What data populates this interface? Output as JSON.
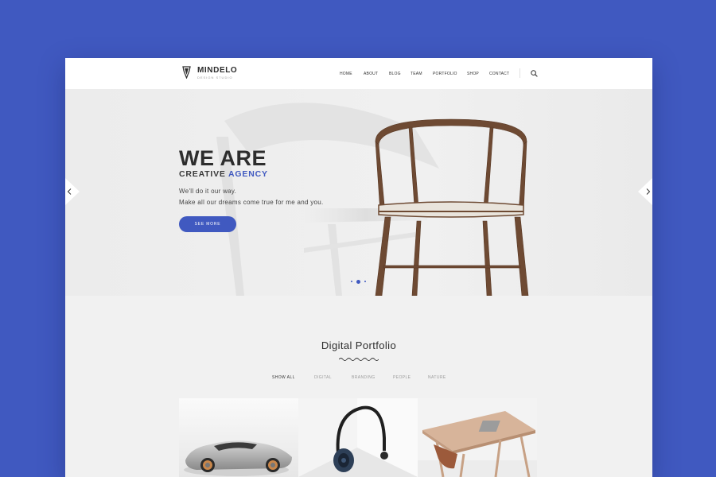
{
  "brand": {
    "name": "MINDELO",
    "tagline": "DESIGN STUDIO"
  },
  "nav": {
    "items": [
      {
        "label": "HOME"
      },
      {
        "label": "ABOUT"
      },
      {
        "label": "BLOG"
      },
      {
        "label": "TEAM"
      },
      {
        "label": "PORTFOLIO"
      },
      {
        "label": "SHOP"
      },
      {
        "label": "CONTACT"
      }
    ],
    "search_icon": "search-icon"
  },
  "hero": {
    "title": "WE ARE",
    "subtitle_prefix": "CREATIVE",
    "subtitle_accent": "AGENCY",
    "line1": "We'll do it our way.",
    "line2": "Make all our dreams come true for me and you.",
    "button_label": "SEE MORE",
    "slides_total": 3,
    "slide_active": 2,
    "prev_icon": "chevron-left-icon",
    "next_icon": "chevron-right-icon"
  },
  "portfolio": {
    "title": "Digital Portfolio",
    "filters": [
      {
        "label": "SHOW ALL",
        "active": true
      },
      {
        "label": "DIGITAL",
        "active": false
      },
      {
        "label": "BRANDING",
        "active": false
      },
      {
        "label": "PEOPLE",
        "active": false
      },
      {
        "label": "NATURE",
        "active": false
      }
    ]
  },
  "colors": {
    "accent": "#4059c0",
    "background": "#4059c0",
    "header": "#ffffff",
    "page": "#f1f1f1"
  }
}
